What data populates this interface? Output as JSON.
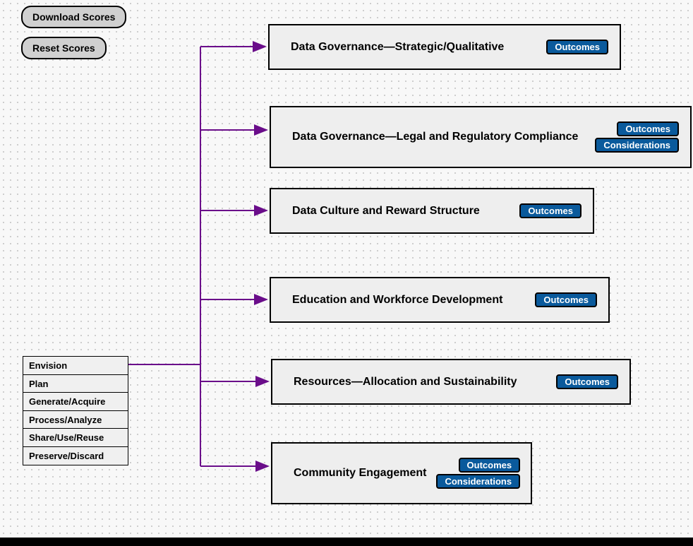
{
  "buttons": {
    "download": "Download Scores",
    "reset": "Reset Scores"
  },
  "stages": [
    "Envision",
    "Plan",
    "Generate/Acquire",
    "Process/Analyze",
    "Share/Use/Reuse",
    "Preserve/Discard"
  ],
  "nodes": [
    {
      "title": "Data Governance—Strategic/Qualitative",
      "badges": [
        "Outcomes"
      ]
    },
    {
      "title": "Data Governance—Legal and Regulatory Compliance",
      "badges": [
        "Outcomes",
        "Considerations"
      ]
    },
    {
      "title": "Data Culture and Reward Structure",
      "badges": [
        "Outcomes"
      ]
    },
    {
      "title": "Education and Workforce Development",
      "badges": [
        "Outcomes"
      ]
    },
    {
      "title": "Resources—Allocation and Sustainability",
      "badges": [
        "Outcomes"
      ]
    },
    {
      "title": "Community Engagement",
      "badges": [
        "Outcomes",
        "Considerations"
      ]
    }
  ]
}
